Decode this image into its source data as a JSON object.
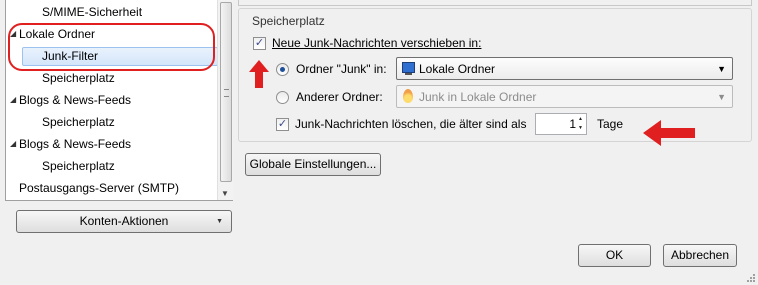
{
  "tree": {
    "items": [
      {
        "label": "S/MIME-Sicherheit",
        "level": 1,
        "twisty": ""
      },
      {
        "label": "Lokale Ordner",
        "level": 0,
        "twisty": "◢"
      },
      {
        "label": "Junk-Filter",
        "level": 1,
        "twisty": "",
        "selected": true
      },
      {
        "label": "Speicherplatz",
        "level": 1,
        "twisty": ""
      },
      {
        "label": "Blogs & News-Feeds",
        "level": 0,
        "twisty": "◢"
      },
      {
        "label": "Speicherplatz",
        "level": 1,
        "twisty": ""
      },
      {
        "label": "Blogs & News-Feeds",
        "level": 0,
        "twisty": "◢"
      },
      {
        "label": "Speicherplatz",
        "level": 1,
        "twisty": ""
      },
      {
        "label": "Postausgangs-Server (SMTP)",
        "level": 0,
        "twisty": ""
      }
    ]
  },
  "account_actions": {
    "label": "Konten-Aktionen",
    "dropdown_glyph": "▼"
  },
  "storage": {
    "group_title": "Speicherplatz",
    "move_checkbox": {
      "label": "Neue Junk-Nachrichten verschieben in:",
      "checked": true
    },
    "junk_radio": {
      "label": "Ordner \"Junk\" in:",
      "selected": true
    },
    "junk_select": {
      "value": "Lokale Ordner",
      "icon": "monitor-icon"
    },
    "other_radio": {
      "label": "Anderer Ordner:",
      "selected": false
    },
    "other_select": {
      "value": "Junk in Lokale Ordner",
      "icon": "flame-icon",
      "disabled": true
    },
    "delete_checkbox": {
      "label": "Junk-Nachrichten löschen, die älter sind als",
      "checked": true
    },
    "days_value": "1",
    "days_unit": "Tage"
  },
  "global_settings": {
    "label": "Globale Einstellungen..."
  },
  "dialog": {
    "ok_label": "OK",
    "cancel_label": "Abbrechen"
  },
  "glyphs": {
    "check": "✓",
    "caret": "▼",
    "spin_up": "▲",
    "spin_down": "▼"
  },
  "colors": {
    "annotation_red": "#e02020",
    "selection": "#d4e6fb"
  }
}
